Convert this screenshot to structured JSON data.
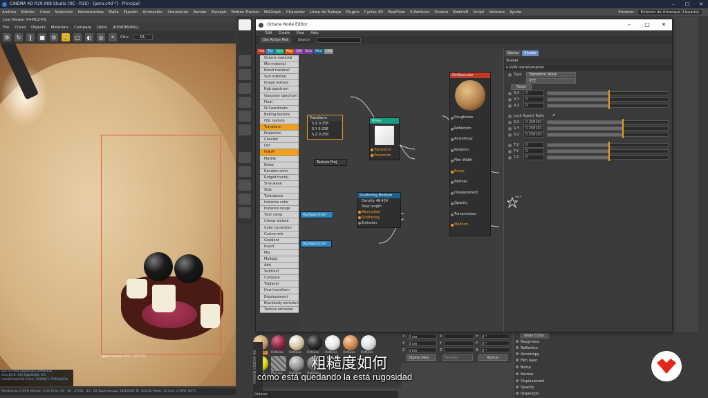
{
  "app": {
    "title": "CINEMA 4D R19.068 Studio (RC - R19) - [pera.c4d *] - Principal",
    "menu": [
      "Archivo",
      "Edición",
      "Crear",
      "Selección",
      "Herramientas",
      "Malla",
      "Fijación",
      "Animación",
      "Simulación",
      "Render",
      "Esculpir",
      "Motion Tracker",
      "MoGraph",
      "Character",
      "Línea de Trabajo",
      "Plugins",
      "Cycles 4D",
      "RealFlow",
      "X-Particles",
      "Octane",
      "Redshift",
      "Script",
      "Ventana",
      "Ayuda"
    ],
    "layout_label": "Entorno:",
    "layout_value": "Entorno de Arranque (Usuario)"
  },
  "viewer": {
    "title": "Live Viewer V4-RC2-R1",
    "menu": [
      "File",
      "Cloud",
      "Objects",
      "Materials",
      "Compare",
      "Optio",
      "[RENDERING]"
    ],
    "chn_label": "Chn:",
    "chn_value": "DL",
    "resolution": "spp/maxspp:480 / 187371",
    "stats": [
      "Out-of-core used/max:16Mb/4Gb",
      "Grey8/16: 0/0      Rgb32/64: 0/1",
      "Used/free/total vram: 358Mb/1.799Gb/6Gb"
    ],
    "status": "Rendering: 0.35%    Ms/sec: 3.55    Time: 00 : 00 : 27/02 : 41 : 05    Spp/maxspp: 56/16000    Tri: 0/124k    Mesh: 14    Hair: 0    GPU: 84°C"
  },
  "node_editor": {
    "title": "Octane Node Editor",
    "menu": [
      "Edit",
      "Create",
      "View",
      "Help"
    ],
    "get_active_mat": "Get Active Mat",
    "search_label": "Search",
    "tabs": [
      {
        "label": "Mat",
        "color": "#c0392b"
      },
      {
        "label": "Tex",
        "color": "#2e86c1"
      },
      {
        "label": "Gen",
        "color": "#16a085"
      },
      {
        "label": "Map",
        "color": "#d35400"
      },
      {
        "label": "Oth",
        "color": "#8e44ad"
      },
      {
        "label": "Ems",
        "color": "#7d3c98"
      },
      {
        "label": "Med",
        "color": "#1f618d"
      },
      {
        "label": "C4D",
        "color": "#7f8c8d"
      }
    ],
    "node_list": [
      {
        "label": "Octane material",
        "cat": "#c0392b"
      },
      {
        "label": "Mix material",
        "cat": "#c0392b"
      },
      {
        "label": "Blend material",
        "cat": "#c0392b"
      },
      {
        "label": "Sub material",
        "cat": "#c0392b"
      },
      {
        "label": "Image texture",
        "cat": "#2e86c1"
      },
      {
        "label": "Rgb spectrum",
        "cat": "#2e86c1"
      },
      {
        "label": "Gaussian spectrum",
        "cat": "#2e86c1"
      },
      {
        "label": "Float",
        "cat": "#2e86c1"
      },
      {
        "label": "W Coordinate",
        "cat": "#2e86c1"
      },
      {
        "label": "Baking texture",
        "cat": "#2e86c1"
      },
      {
        "label": "OSL texture",
        "cat": "#2e86c1"
      },
      {
        "label": "Transform",
        "cat": "#d35400",
        "hl": true
      },
      {
        "label": "Projection",
        "cat": "#d35400"
      },
      {
        "label": "Checker",
        "cat": "#16a085"
      },
      {
        "label": "Dirt",
        "cat": "#16a085"
      },
      {
        "label": "Falloff",
        "cat": "#16a085",
        "hl": true
      },
      {
        "label": "Marble",
        "cat": "#16a085"
      },
      {
        "label": "Noise",
        "cat": "#16a085"
      },
      {
        "label": "Random color",
        "cat": "#16a085"
      },
      {
        "label": "Ridged fractal",
        "cat": "#16a085"
      },
      {
        "label": "Sine wave",
        "cat": "#16a085"
      },
      {
        "label": "Side",
        "cat": "#16a085"
      },
      {
        "label": "Turbulence",
        "cat": "#16a085"
      },
      {
        "label": "Instance color",
        "cat": "#16a085"
      },
      {
        "label": "Instance range",
        "cat": "#16a085"
      },
      {
        "label": "Toon ramp",
        "cat": "#16a085"
      },
      {
        "label": "Clamp texture",
        "cat": "#8e44ad"
      },
      {
        "label": "Color correction",
        "cat": "#8e44ad"
      },
      {
        "label": "Cosine mix",
        "cat": "#8e44ad"
      },
      {
        "label": "Gradient",
        "cat": "#8e44ad"
      },
      {
        "label": "Invert",
        "cat": "#8e44ad"
      },
      {
        "label": "Mix",
        "cat": "#8e44ad"
      },
      {
        "label": "Multiply",
        "cat": "#8e44ad"
      },
      {
        "label": "Add",
        "cat": "#8e44ad"
      },
      {
        "label": "Subtract",
        "cat": "#8e44ad"
      },
      {
        "label": "Compare",
        "cat": "#8e44ad"
      },
      {
        "label": "Triplanar",
        "cat": "#8e44ad"
      },
      {
        "label": "Uvw transform",
        "cat": "#8e44ad"
      },
      {
        "label": "Displacement",
        "cat": "#7d3c98"
      },
      {
        "label": "Blackbody emission",
        "cat": "#7d3c98"
      },
      {
        "label": "Texture emission",
        "cat": "#7d3c98"
      }
    ],
    "nodes": {
      "transform": {
        "title": "Transform",
        "rows": [
          "S.X  0.258",
          "S.Y  0.258",
          "S.Z  0.258"
        ]
      },
      "texture_proj": {
        "title": "Texture Proj"
      },
      "noise": {
        "title": "Noise",
        "rows": [
          "Transform",
          "Projection"
        ]
      },
      "scattering": {
        "title": "Scattering Medium",
        "rows": [
          "Density  46.424",
          "Step length",
          "Absorption",
          "Scattering",
          "Emission"
        ]
      },
      "rgb1": {
        "title": "RgbSpectrum"
      },
      "rgb2": {
        "title": "RgbSpectrum"
      },
      "octspecular": {
        "title": "OctSpecular",
        "rows": [
          "Roughness",
          "Reflection",
          "Anisotropy",
          "Rotation",
          "Film Width",
          "Bump",
          "Normal",
          "Displacement",
          "Opacity",
          "Transmission",
          "Medium"
        ]
      }
    },
    "inspector": {
      "tabs": [
        "Básico",
        "Shader"
      ],
      "section": "Shader",
      "group": "UVW transformation",
      "type_label": "Type",
      "type_value": "Transform Value",
      "type_sub": "XYZ",
      "reset": "Reset",
      "rotation": [
        {
          "label": "R.X",
          "value": "0"
        },
        {
          "label": "R.Y",
          "value": "0"
        },
        {
          "label": "R.Z",
          "value": "0"
        }
      ],
      "lock_label": "Lock Aspect Ratio",
      "scale": [
        {
          "label": "S.X",
          "value": "0.258191"
        },
        {
          "label": "S.Y",
          "value": "0.258191"
        },
        {
          "label": "S.Z",
          "value": "0.258191"
        }
      ],
      "translation": [
        {
          "label": "T.X",
          "value": "0"
        },
        {
          "label": "T.Y",
          "value": "0"
        },
        {
          "label": "T.Z",
          "value": "0"
        }
      ],
      "help": "HELP"
    }
  },
  "materials": [
    {
      "label": "OctSpec",
      "color": "#c7a070"
    },
    {
      "label": "OctGlos",
      "color": "#8a2a40"
    },
    {
      "label": "OctGlos",
      "color": "#d8c9a8"
    },
    {
      "label": "OctGlos",
      "color": "#2a2a2a"
    },
    {
      "label": "OctGlos",
      "color": "#e8e8e8"
    },
    {
      "label": "OctGlos",
      "color": "#d08a5a"
    },
    {
      "label": "OctGlos",
      "color": "#e0e0e0"
    }
  ],
  "materials_row2": [
    {
      "label": "OctDiff",
      "color": "#e0e020"
    },
    {
      "label": "Mat.ixu",
      "color": "#b0b0b0"
    },
    {
      "label": "OctGlos",
      "color": "#9a9a9a"
    },
    {
      "label": "OctGlos",
      "color": "#666"
    }
  ],
  "coords": {
    "x": "0 cm",
    "y": "0 cm",
    "z": "0 cm",
    "h": "0 °",
    "p": "0 °",
    "b": "0 °",
    "object_dd": "Objeto (Rel)",
    "size_dd": "Tamaño",
    "apply": "Aplicar"
  },
  "octane_bar": "Octane:",
  "maxon": "MAXON CINEMA 4D",
  "attr": {
    "node_editor_btn": "Node Editor",
    "items": [
      "Roughness",
      "Reflection",
      "Anisotropy",
      "Film layer",
      "Bump",
      "Normal",
      "Displacement",
      "Opacity",
      "Dispersion"
    ]
  },
  "subtitles": {
    "chinese": "粗糙度如何",
    "spanish": "cómo está quedando la está rugosidad"
  }
}
